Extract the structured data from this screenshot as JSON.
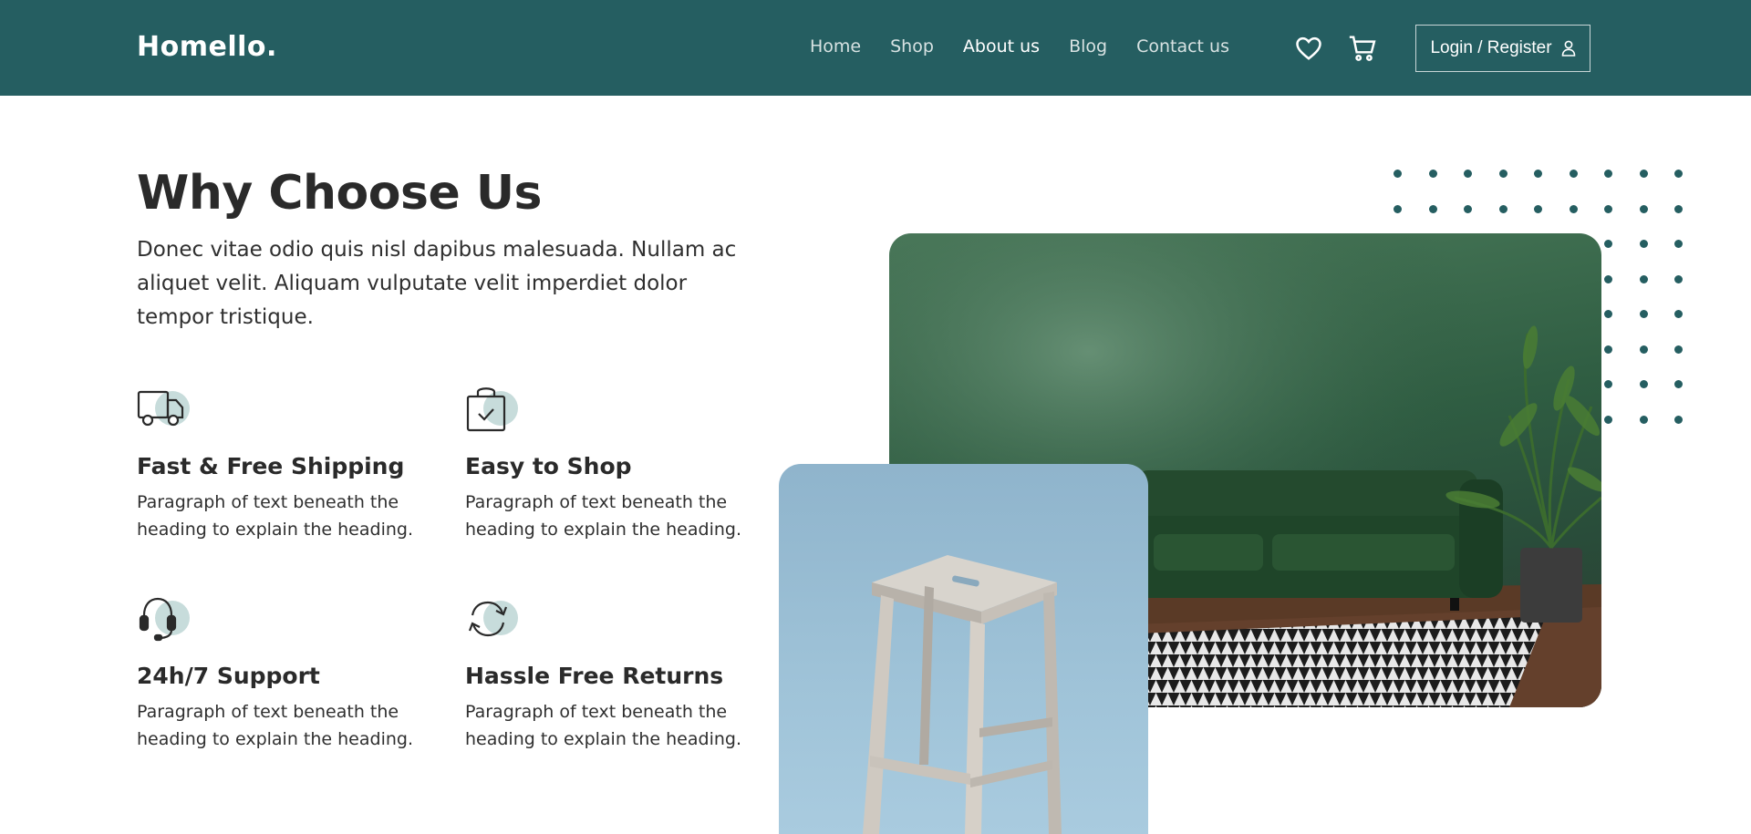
{
  "brand": "Homello.",
  "nav": {
    "links": [
      {
        "label": "Home"
      },
      {
        "label": "Shop"
      },
      {
        "label": "About us"
      },
      {
        "label": "Blog"
      },
      {
        "label": "Contact us"
      }
    ],
    "active": "About us",
    "wishlist_icon": "heart-icon",
    "cart_icon": "cart-icon",
    "login_label": "Login / Register",
    "login_icon": "user-icon"
  },
  "why": {
    "title": "Why Choose Us",
    "description": "Donec vitae odio quis nisl dapibus malesuada. Nullam ac aliquet velit. Aliquam vulputate velit imperdiet dolor tempor tristique.",
    "features": [
      {
        "icon": "truck-icon",
        "title": "Fast & Free Shipping",
        "text": "Paragraph of text beneath the heading to explain the heading."
      },
      {
        "icon": "shopping-bag-icon",
        "title": "Easy to Shop",
        "text": "Paragraph of text beneath the heading to explain the heading."
      },
      {
        "icon": "headset-icon",
        "title": "24h/7 Support",
        "text": "Paragraph of text beneath the heading to explain the heading."
      },
      {
        "icon": "return-icon",
        "title": "Hassle Free Returns",
        "text": "Paragraph of text beneath the heading to explain the heading."
      }
    ]
  },
  "colors": {
    "primary": "#255e61",
    "icon_bg": "#c7dcdb",
    "text_dark": "#2a2a2a"
  }
}
